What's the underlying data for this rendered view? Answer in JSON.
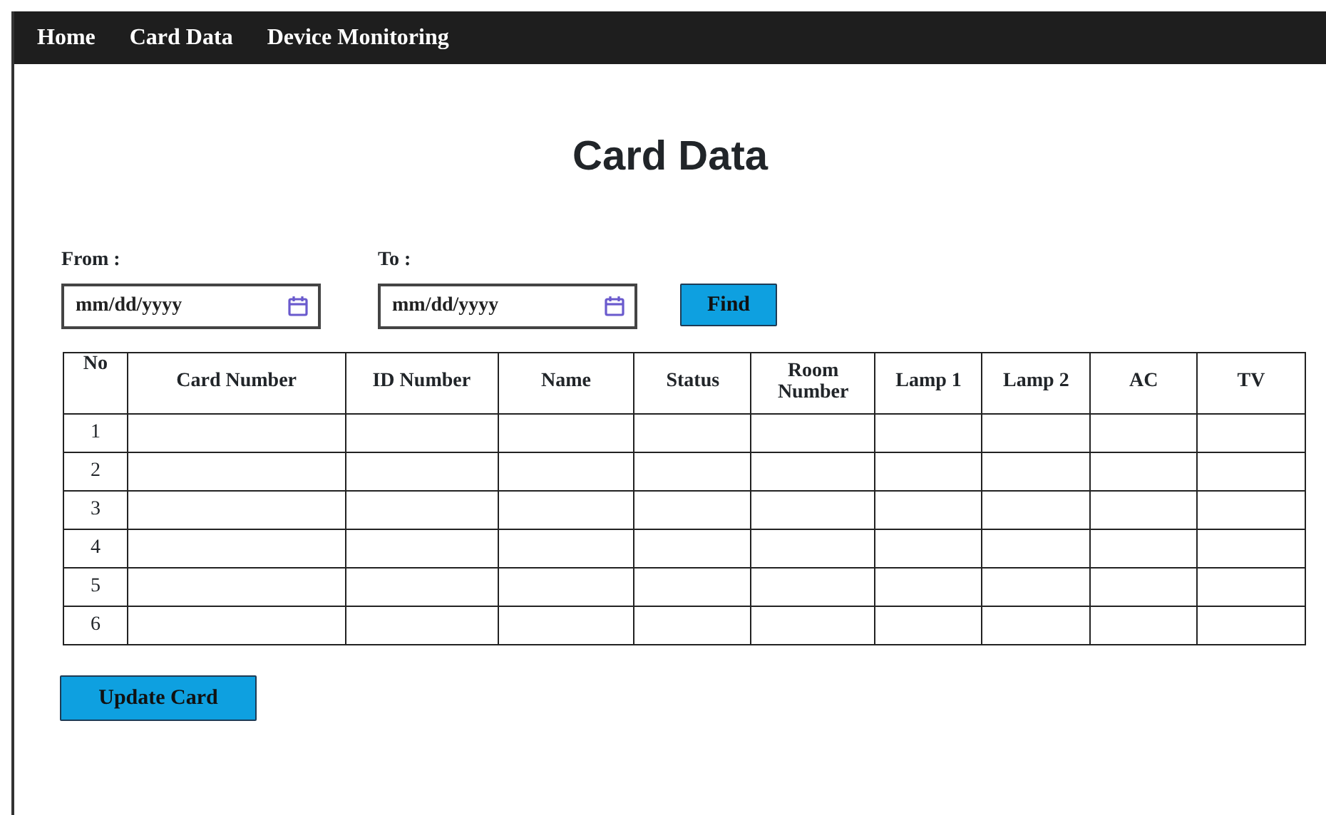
{
  "navbar": {
    "items": [
      "Home",
      "Card Data",
      "Device Monitoring"
    ]
  },
  "title": "Card Data",
  "filters": [
    {
      "label": "From :",
      "placeholder": "mm/dd/yyyy"
    },
    {
      "label": "To :",
      "placeholder": "mm/dd/yyyy"
    }
  ],
  "find_button": "Find",
  "table": {
    "columns": [
      "No",
      "Card Number",
      "ID Number",
      "Name",
      "Status",
      "Room Number",
      "Lamp 1",
      "Lamp 2",
      "AC",
      "TV"
    ],
    "rows": [
      {
        "no": "1"
      },
      {
        "no": "2"
      },
      {
        "no": "3"
      },
      {
        "no": "4"
      },
      {
        "no": "5"
      },
      {
        "no": "6"
      }
    ]
  },
  "update_button": "Update Card"
}
